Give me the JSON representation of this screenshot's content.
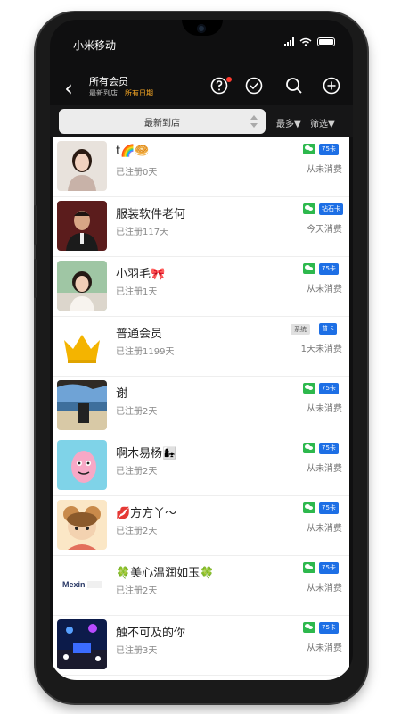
{
  "status_bar": {
    "carrier": "小米移动"
  },
  "header": {
    "title": "所有会员",
    "subtitle_sort": "最新到店",
    "subtitle_filter": "所有日期",
    "icons": [
      "help-icon",
      "check-circle-icon",
      "search-icon",
      "add-icon"
    ]
  },
  "filter": {
    "sort_label": "最新到店",
    "more_label": "最多▼",
    "filter_label": "筛选▼"
  },
  "colors": {
    "accent": "#1d6fe5",
    "wechat": "#2db84d",
    "highlight": "#f5a623"
  },
  "members": [
    {
      "name": "t🌈🥯",
      "registered": "已注册0天",
      "badge": "wechat",
      "card": "75卡",
      "consumption": "从未消费"
    },
    {
      "name": "服装软件老何",
      "registered": "已注册117天",
      "badge": "wechat",
      "card": "钻石卡",
      "consumption": "今天消费"
    },
    {
      "name": "小羽毛🎀",
      "registered": "已注册1天",
      "badge": "wechat",
      "card": "75卡",
      "consumption": "从未消费"
    },
    {
      "name": "普通会员",
      "registered": "已注册1199天",
      "badge": "系统",
      "card": "普卡",
      "consumption": "1天未消费"
    },
    {
      "name": "谢",
      "registered": "已注册2天",
      "badge": "wechat",
      "card": "75卡",
      "consumption": "从未消费"
    },
    {
      "name": "啊木易杨👩‍👧",
      "registered": "已注册2天",
      "badge": "wechat",
      "card": "75卡",
      "consumption": "从未消费"
    },
    {
      "name": "💋方方丫～",
      "registered": "已注册2天",
      "badge": "wechat",
      "card": "75卡",
      "consumption": "从未消费"
    },
    {
      "name": "🍀美心温润如玉🍀",
      "registered": "已注册2天",
      "badge": "wechat",
      "card": "75卡",
      "consumption": "从未消费"
    },
    {
      "name": "触不可及的你",
      "registered": "已注册3天",
      "badge": "wechat",
      "card": "75卡",
      "consumption": "从未消费"
    }
  ],
  "logo_text": "Mexin"
}
